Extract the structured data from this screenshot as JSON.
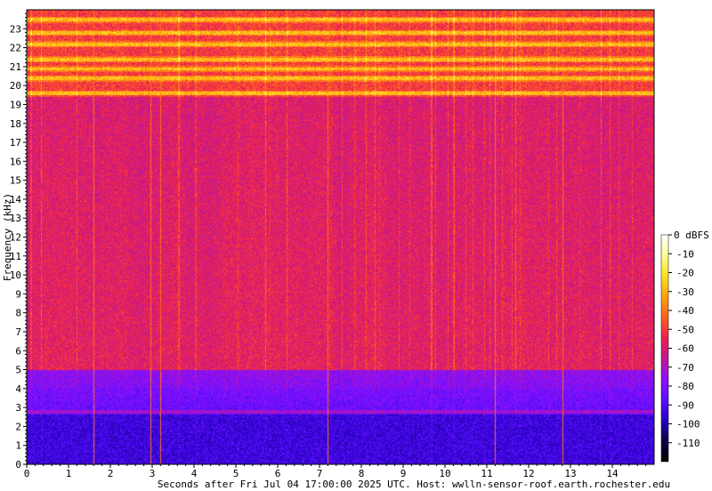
{
  "chart_data": {
    "type": "heatmap",
    "title": "",
    "xlabel": "Seconds after Fri Jul 04 17:00:00 2025 UTC. Host: wwlln-sensor-roof.earth.rochester.edu",
    "ylabel": "Frequency (kHz)",
    "xlim": [
      0,
      15
    ],
    "ylim": [
      0,
      24
    ],
    "x_ticks": [
      "0",
      "1",
      "2",
      "3",
      "4",
      "5",
      "6",
      "7",
      "8",
      "9",
      "10",
      "11",
      "12",
      "13",
      "14"
    ],
    "y_ticks": [
      "0",
      "1",
      "2",
      "3",
      "4",
      "5",
      "6",
      "7",
      "8",
      "9",
      "10",
      "11",
      "12",
      "13",
      "14",
      "15",
      "16",
      "17",
      "18",
      "19",
      "20",
      "21",
      "22",
      "23"
    ],
    "colorbar": {
      "unit_label": "0 dBFS",
      "range": [
        -120,
        0
      ],
      "ticks": [
        "-10",
        "-20",
        "-30",
        "-40",
        "-50",
        "-60",
        "-70",
        "-80",
        "-90",
        "-100",
        "-110"
      ]
    },
    "colormap": [
      "#000000",
      "#10004a",
      "#2a00c8",
      "#5a10ff",
      "#9010ff",
      "#c01890",
      "#ee2050",
      "#ff6020",
      "#ffa010",
      "#ffe020",
      "#ffff90",
      "#ffffff"
    ],
    "narrowband_lines_khz": [
      2.8,
      19.6,
      20.4,
      20.9,
      21.4,
      22.2,
      22.8,
      23.5
    ],
    "noise_floor_dbfs": {
      "below_3khz": -95,
      "3_to_5khz": -85,
      "5_to_20khz": -62,
      "above_20khz": -55
    },
    "impulsive_columns_s": [
      1.6,
      2.95,
      3.2,
      7.2,
      11.2,
      12.8
    ]
  }
}
